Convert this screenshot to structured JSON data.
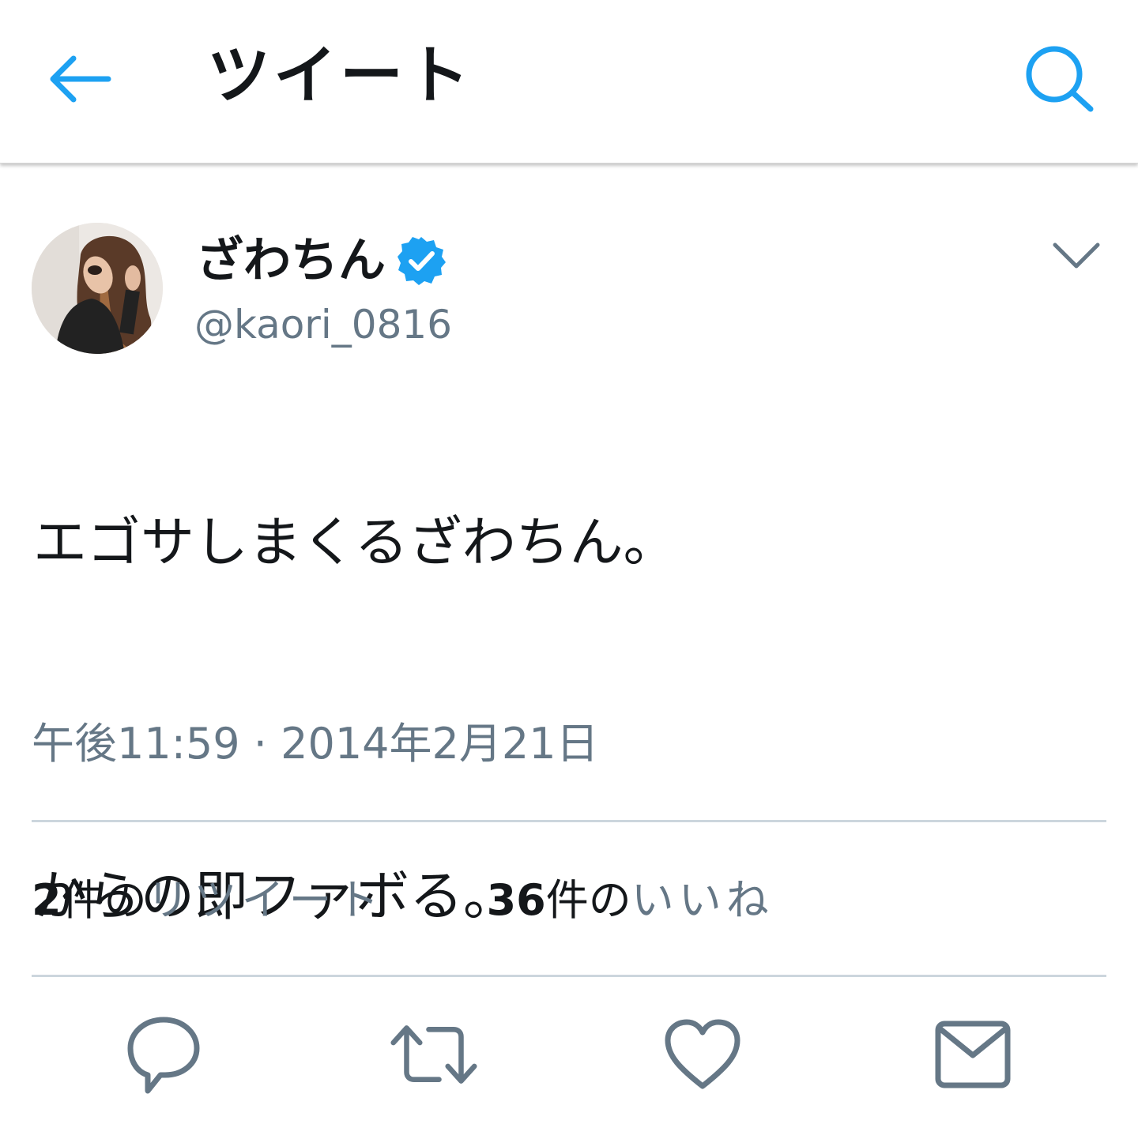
{
  "header": {
    "title": "ツイート",
    "back_icon": "arrow-left-icon",
    "search_icon": "search-icon",
    "accent_color": "#1da1f2"
  },
  "tweet": {
    "author": {
      "display_name": "ざわちん",
      "username": "@kaori_0816",
      "verified": true,
      "verified_icon": "verified-badge-icon"
    },
    "text_lines": [
      "エゴサしまくるざわちん。",
      "",
      "からの即ファボる。"
    ],
    "timestamp": "午後11:59 · 2014年2月21日",
    "caret_icon": "chevron-down-icon"
  },
  "stats": {
    "retweets": {
      "count": "2",
      "unit": "件の",
      "label": "リツイート"
    },
    "likes": {
      "count": "36",
      "unit": "件の",
      "label": "いいね"
    }
  },
  "actions": [
    {
      "name": "reply",
      "icon": "reply-icon"
    },
    {
      "name": "retweet",
      "icon": "retweet-icon"
    },
    {
      "name": "like",
      "icon": "heart-icon"
    },
    {
      "name": "direct-message",
      "icon": "envelope-icon"
    }
  ],
  "colors": {
    "text_primary": "#14171a",
    "text_secondary": "#657786",
    "divider": "#ccd6dd",
    "icon_gray": "#657786"
  }
}
